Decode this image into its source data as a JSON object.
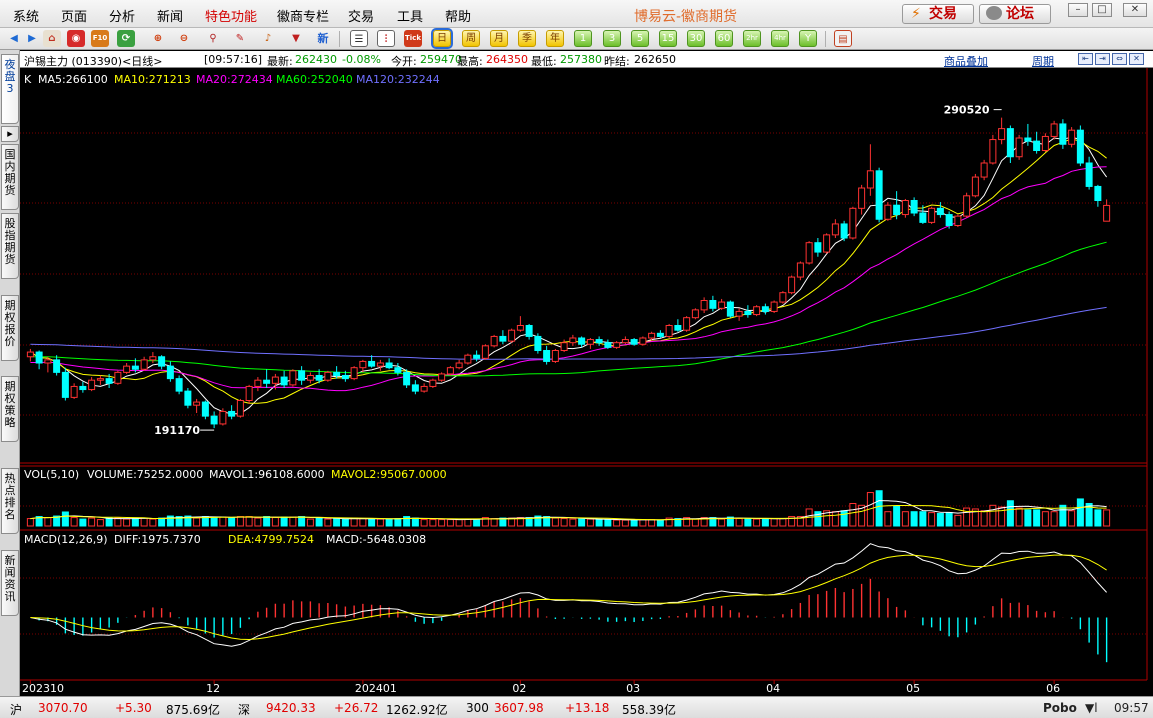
{
  "menu": {
    "items": [
      "系统",
      "页面",
      "分析",
      "新闻",
      "特色功能",
      "徽商专栏",
      "交易",
      "工具",
      "帮助"
    ],
    "active_index": 4,
    "app_title": "博易云-徽商期货",
    "trade_button": "交易",
    "forum_button": "论坛"
  },
  "toolbar": {
    "periods": [
      "日",
      "周",
      "月",
      "季",
      "年",
      "1",
      "3",
      "5",
      "15",
      "30",
      "60",
      "2hr",
      "4hr",
      "Y"
    ],
    "selected_period": "日",
    "news_icon_label": "新",
    "tick_label": "Tick"
  },
  "left_tabs": [
    {
      "label": "夜盘3",
      "active": true
    },
    {
      "label": "国内期货",
      "active": false
    },
    {
      "label": "股指期货",
      "active": false
    },
    {
      "label": "期权报价",
      "active": false
    },
    {
      "label": "期权策略",
      "active": false
    },
    {
      "label": "热点排名",
      "active": false
    },
    {
      "label": "新闻资讯",
      "active": false
    }
  ],
  "header": {
    "symbol": "沪锡主力 (013390)<日线>",
    "time": "[09:57:16]",
    "last_label": "最新:",
    "last_value": "262430",
    "change": "-0.08%",
    "open_label": "今开:",
    "open_value": "259470",
    "high_label": "最高:",
    "high_value": "264350",
    "low_label": "最低:",
    "low_value": "257380",
    "prev_label": "昨结:",
    "prev_value": "262650",
    "overlay_link": "商品叠加",
    "period_link": "周期"
  },
  "indicators": {
    "k_label": "K",
    "ma5": "MA5:266100",
    "ma10": "MA10:271213",
    "ma20": "MA20:272434",
    "ma60": "MA60:252040",
    "ma120": "MA120:232244",
    "vol_name": "VOL(5,10)",
    "volume": "VOLUME:75252.0000",
    "mavol1": "MAVOL1:96108.6000",
    "mavol2": "MAVOL2:95067.0000",
    "macd_name": "MACD(12,26,9)",
    "diff": "DIFF:1975.7370",
    "dea": "DEA:4799.7524",
    "macd": "MACD:-5648.0308"
  },
  "chart_data": {
    "type": "candlestick",
    "interval": "daily",
    "max_label": "290520",
    "min_label": "191170",
    "price_range": [
      180000,
      300000
    ],
    "x_ticks": [
      "202310",
      "12",
      "202401",
      "02",
      "03",
      "04",
      "05",
      "06"
    ],
    "colors": {
      "up": "#ff3232",
      "down": "#00ffff",
      "ma5": "#ffffff",
      "ma10": "#ffff00",
      "ma20": "#ff00ff",
      "ma60": "#00ff00",
      "ma120": "#7070ff"
    },
    "candles": [
      [
        214000,
        216500,
        212500,
        215500
      ],
      [
        215500,
        216000,
        210000,
        212000
      ],
      [
        212000,
        214000,
        209000,
        213000
      ],
      [
        213000,
        214500,
        208000,
        209000
      ],
      [
        209000,
        210500,
        200000,
        201000
      ],
      [
        201000,
        205500,
        200500,
        204500
      ],
      [
        204500,
        206000,
        202500,
        203500
      ],
      [
        203500,
        207500,
        203000,
        206500
      ],
      [
        206500,
        208000,
        205000,
        207000
      ],
      [
        207000,
        208500,
        204000,
        205500
      ],
      [
        205500,
        209500,
        205000,
        209000
      ],
      [
        209000,
        212000,
        208500,
        211000
      ],
      [
        211000,
        213500,
        209000,
        210000
      ],
      [
        210000,
        214000,
        209500,
        213000
      ],
      [
        213000,
        215500,
        212000,
        214000
      ],
      [
        214000,
        214500,
        210000,
        211000
      ],
      [
        211000,
        212500,
        206000,
        207000
      ],
      [
        207000,
        208000,
        202000,
        203000
      ],
      [
        203000,
        204000,
        197500,
        198500
      ],
      [
        198500,
        200500,
        196000,
        199500
      ],
      [
        199500,
        200000,
        194000,
        195000
      ],
      [
        195000,
        196500,
        191170,
        192500
      ],
      [
        192500,
        197500,
        192000,
        196500
      ],
      [
        196500,
        198500,
        194000,
        195000
      ],
      [
        195000,
        200500,
        194500,
        200000
      ],
      [
        200000,
        205000,
        199000,
        204500
      ],
      [
        204500,
        207500,
        203000,
        206500
      ],
      [
        206500,
        210000,
        204000,
        205500
      ],
      [
        205500,
        208500,
        203500,
        207500
      ],
      [
        207500,
        209500,
        204000,
        205000
      ],
      [
        205000,
        210000,
        204500,
        209500
      ],
      [
        209500,
        211000,
        205000,
        206500
      ],
      [
        206500,
        209000,
        205500,
        208000
      ],
      [
        208000,
        210000,
        205500,
        206500
      ],
      [
        206500,
        209500,
        206000,
        209000
      ],
      [
        209000,
        211000,
        207000,
        208000
      ],
      [
        208000,
        209500,
        206000,
        207000
      ],
      [
        207000,
        211000,
        206500,
        210500
      ],
      [
        210500,
        213000,
        209000,
        212500
      ],
      [
        212500,
        214500,
        210500,
        211000
      ],
      [
        211000,
        213000,
        209500,
        212000
      ],
      [
        212000,
        213500,
        210000,
        210500
      ],
      [
        210500,
        212000,
        208000,
        209000
      ],
      [
        209000,
        210000,
        204000,
        205000
      ],
      [
        205000,
        206500,
        202000,
        203000
      ],
      [
        203000,
        205500,
        202500,
        204500
      ],
      [
        204500,
        207000,
        204000,
        206500
      ],
      [
        206500,
        209000,
        206000,
        208500
      ],
      [
        208500,
        211000,
        208000,
        210500
      ],
      [
        210500,
        213000,
        210000,
        212000
      ],
      [
        212000,
        215000,
        211500,
        214500
      ],
      [
        214500,
        216000,
        212500,
        213500
      ],
      [
        213500,
        218000,
        213000,
        217500
      ],
      [
        217500,
        221000,
        217000,
        220500
      ],
      [
        220500,
        222500,
        218000,
        219000
      ],
      [
        219000,
        223000,
        218500,
        222500
      ],
      [
        222500,
        227000,
        222000,
        224000
      ],
      [
        224000,
        224500,
        219500,
        220500
      ],
      [
        220500,
        221500,
        215000,
        216000
      ],
      [
        216000,
        217500,
        211500,
        212500
      ],
      [
        212500,
        216500,
        212000,
        216000
      ],
      [
        216000,
        219500,
        215500,
        218500
      ],
      [
        218500,
        221000,
        217500,
        220000
      ],
      [
        220000,
        220500,
        217000,
        218000
      ],
      [
        218000,
        220000,
        216500,
        219500
      ],
      [
        219500,
        220500,
        217500,
        218500
      ],
      [
        218500,
        219500,
        216500,
        217000
      ],
      [
        217000,
        219000,
        216500,
        218500
      ],
      [
        218500,
        220500,
        218000,
        219500
      ],
      [
        219500,
        220000,
        217500,
        218000
      ],
      [
        218000,
        220500,
        217500,
        220000
      ],
      [
        220000,
        222000,
        219000,
        221500
      ],
      [
        221500,
        222500,
        220000,
        220500
      ],
      [
        220500,
        224500,
        220000,
        224000
      ],
      [
        224000,
        226000,
        222000,
        222500
      ],
      [
        222500,
        227000,
        222000,
        226500
      ],
      [
        226500,
        229500,
        226000,
        229000
      ],
      [
        229000,
        233000,
        228000,
        232000
      ],
      [
        232000,
        233500,
        228500,
        229500
      ],
      [
        229500,
        232500,
        229000,
        231500
      ],
      [
        231500,
        232000,
        226500,
        227000
      ],
      [
        227000,
        229500,
        225500,
        228500
      ],
      [
        228500,
        230500,
        226500,
        227500
      ],
      [
        227500,
        230500,
        227000,
        230000
      ],
      [
        230000,
        231000,
        227500,
        228500
      ],
      [
        228500,
        232000,
        228000,
        231500
      ],
      [
        231500,
        235000,
        231000,
        234500
      ],
      [
        234500,
        240000,
        234000,
        239500
      ],
      [
        239500,
        244500,
        238500,
        244000
      ],
      [
        244000,
        251000,
        243500,
        250500
      ],
      [
        250500,
        252000,
        246000,
        247500
      ],
      [
        247500,
        253500,
        247000,
        253000
      ],
      [
        253000,
        258000,
        252000,
        256500
      ],
      [
        256500,
        257500,
        251000,
        252000
      ],
      [
        252000,
        262000,
        251500,
        261500
      ],
      [
        261500,
        269000,
        259500,
        268000
      ],
      [
        268000,
        282000,
        265500,
        273500
      ],
      [
        273500,
        274500,
        257000,
        258000
      ],
      [
        258000,
        263500,
        257500,
        262500
      ],
      [
        262500,
        267000,
        258000,
        259500
      ],
      [
        259500,
        264500,
        258500,
        264000
      ],
      [
        264000,
        265000,
        259000,
        260000
      ],
      [
        260000,
        262500,
        256500,
        257000
      ],
      [
        257000,
        262000,
        256500,
        261500
      ],
      [
        261500,
        263500,
        258500,
        259500
      ],
      [
        259500,
        260500,
        255000,
        256000
      ],
      [
        256000,
        259500,
        255500,
        259000
      ],
      [
        259000,
        266500,
        258500,
        265500
      ],
      [
        265500,
        272500,
        265000,
        271500
      ],
      [
        271500,
        277000,
        270500,
        276000
      ],
      [
        276000,
        285000,
        275500,
        283500
      ],
      [
        283500,
        290520,
        282000,
        287000
      ],
      [
        287000,
        288000,
        276000,
        278000
      ],
      [
        278000,
        285000,
        277000,
        284000
      ],
      [
        284000,
        288500,
        281500,
        283000
      ],
      [
        283000,
        286000,
        279000,
        280000
      ],
      [
        280000,
        285500,
        279500,
        284500
      ],
      [
        284500,
        289500,
        283500,
        288500
      ],
      [
        288500,
        290000,
        280500,
        282000
      ],
      [
        282000,
        287500,
        281000,
        286500
      ],
      [
        286500,
        288000,
        275000,
        276000
      ],
      [
        276000,
        278000,
        267500,
        268500
      ],
      [
        268500,
        269000,
        262000,
        264000
      ],
      [
        257380,
        264350,
        257380,
        262430
      ]
    ],
    "volume_range": [
      0,
      400000
    ],
    "macd_range": [
      -9000,
      11000
    ]
  },
  "status_bar": {
    "items": [
      {
        "name": "沪",
        "price": "3070.70",
        "change": "+5.30",
        "amount": "875.69亿"
      },
      {
        "name": "深",
        "price": "9420.33",
        "change": "+26.72",
        "amount": "1262.92亿"
      },
      {
        "name": "300",
        "price": "3607.98",
        "change": "+13.18",
        "amount": "558.39亿"
      }
    ],
    "brand": "Pobo",
    "clock": "09:57"
  }
}
